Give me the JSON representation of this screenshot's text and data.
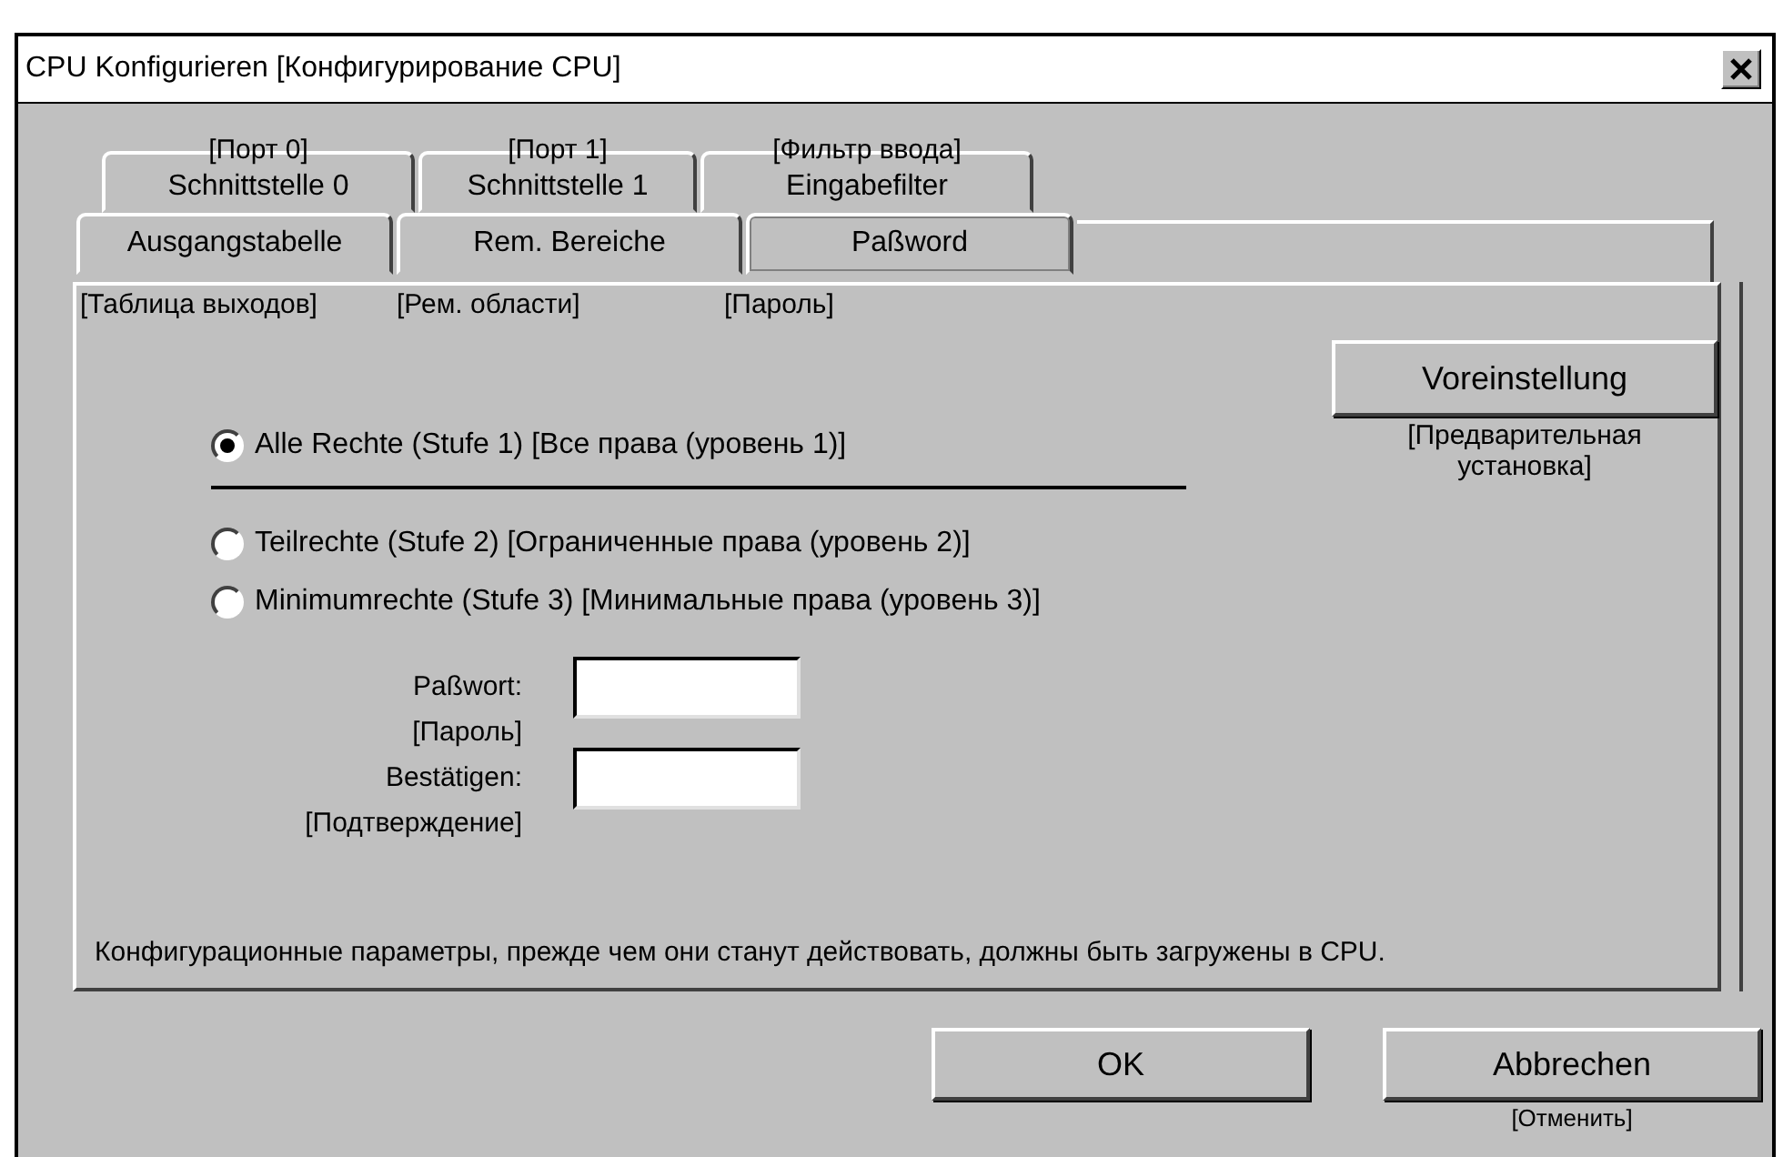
{
  "window": {
    "title": "CPU Konfigurieren [Конфигурирование CPU]"
  },
  "tabs_back": [
    {
      "label": "Schnittstelle 0",
      "note": "[Порт 0]",
      "selected": false
    },
    {
      "label": "Schnittstelle 1",
      "note": "[Порт 1]",
      "selected": false
    },
    {
      "label": "Eingabefilter",
      "note": "[Фильтр ввода]",
      "selected": false
    }
  ],
  "tabs_front": [
    {
      "label": "Ausgangstabelle",
      "note": "[Таблица выходов]",
      "selected": false
    },
    {
      "label": "Rem. Bereiche",
      "note": "[Рем. области]",
      "selected": false
    },
    {
      "label": "Paßword",
      "note": "[Пароль]",
      "selected": true
    }
  ],
  "preset_button": {
    "label": "Voreinstellung",
    "note": "[Предварительная установка]"
  },
  "radios": [
    {
      "label": "Alle Rechte (Stufe 1) [Все права (уровень 1)]",
      "selected": true
    },
    {
      "label": "Teilrechte (Stufe 2) [Ограниченные права (уровень 2)]",
      "selected": false
    },
    {
      "label": "Minimumrechte (Stufe 3) [Минимальные права (уровень 3)]",
      "selected": false
    }
  ],
  "fields": [
    {
      "label": "Paßwort:",
      "note": "[Пароль]"
    },
    {
      "label": "Bestätigen:",
      "note": "[Подтверждение]"
    }
  ],
  "info": "Конфигурационные параметры, прежде чем они станут действовать, должны быть загружены в CPU.",
  "buttons": [
    {
      "label": "OK"
    },
    {
      "label": "Abbrechen",
      "note": "[Отменить]"
    }
  ]
}
